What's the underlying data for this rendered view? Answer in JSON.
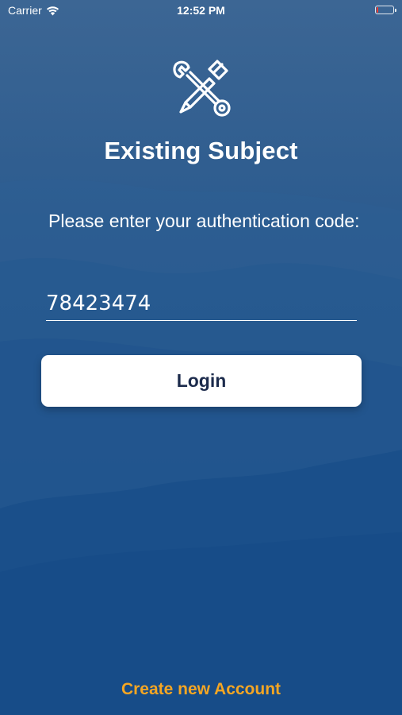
{
  "status_bar": {
    "carrier": "Carrier",
    "time": "12:52 PM",
    "battery_level": 0.1,
    "battery_color": "#ff3b30"
  },
  "header": {
    "icon": "wrench-screwdriver-icon",
    "title": "Existing Subject"
  },
  "form": {
    "prompt": "Please enter your authentication code:",
    "code_value": "78423474"
  },
  "buttons": {
    "login_label": "Login",
    "create_account_label": "Create new Account"
  },
  "colors": {
    "background": "#1f4f86",
    "button_text": "#1c2b4c",
    "link": "#f5a623"
  }
}
